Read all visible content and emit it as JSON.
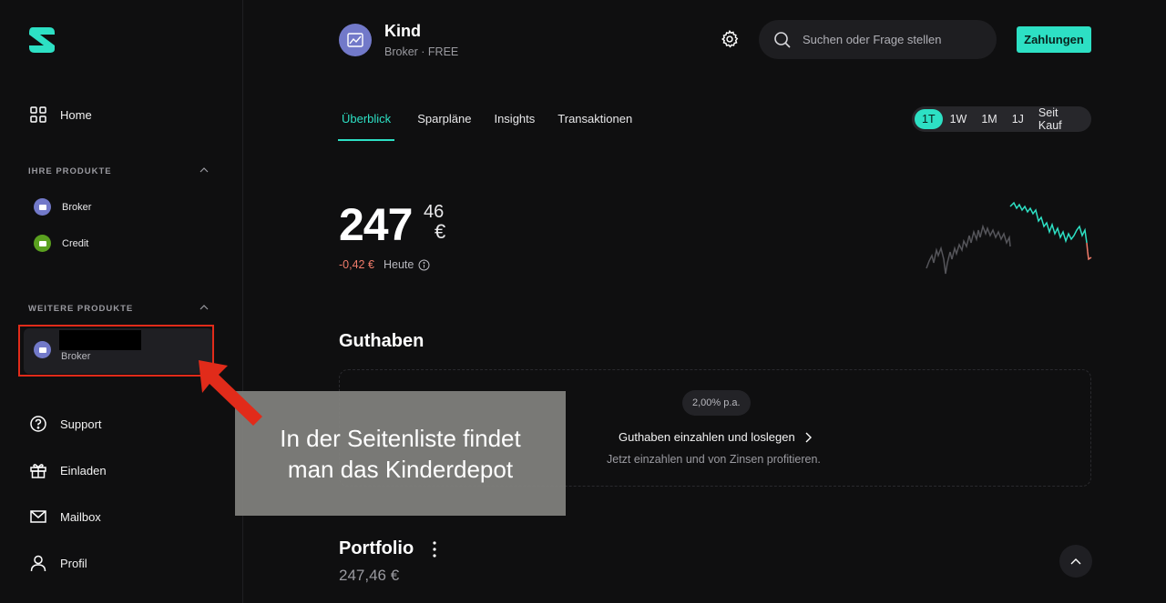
{
  "sidebar": {
    "nav_top": [
      {
        "label": "Home",
        "icon": "grid-icon"
      }
    ],
    "sections": {
      "own_products_title": "IHRE PRODUKTE",
      "other_products_title": "WEITERE PRODUKTE"
    },
    "own_products": [
      {
        "label": "Broker",
        "icon": "broker-icon",
        "color": "#7279c9"
      },
      {
        "label": "Credit",
        "icon": "credit-icon",
        "color": "#5aa01f"
      }
    ],
    "other_products": [
      {
        "label": "Broker",
        "icon": "broker-icon"
      }
    ],
    "nav_bottom": [
      {
        "label": "Support",
        "icon": "help-icon"
      },
      {
        "label": "Einladen",
        "icon": "gift-icon"
      },
      {
        "label": "Mailbox",
        "icon": "mail-icon"
      },
      {
        "label": "Profil",
        "icon": "user-icon"
      }
    ]
  },
  "header": {
    "account_name": "Kind",
    "account_sub": "Broker · FREE",
    "search_placeholder": "Suchen oder Frage stellen",
    "pay_button": "Zahlungen"
  },
  "tabs": [
    "Überblick",
    "Sparpläne",
    "Insights",
    "Transaktionen"
  ],
  "active_tab": "Überblick",
  "ranges": [
    "1T",
    "1W",
    "1M",
    "1J",
    "Seit Kauf"
  ],
  "active_range": "1T",
  "value": {
    "integer": "247",
    "decimal": "46",
    "currency": "€",
    "change": "-0,42 €",
    "change_label": "Heute",
    "change_color": "#f07b6a"
  },
  "guthaben": {
    "title": "Guthaben",
    "rate": "2,00% p.a.",
    "link": "Guthaben einzahlen und loslegen",
    "sub": "Jetzt einzahlen und von Zinsen profitieren."
  },
  "portfolio": {
    "title": "Portfolio",
    "value": "247,46 €"
  },
  "annotation": {
    "text": "In der Seitenliste findet man das Kinderdepot",
    "arrow_color": "#e12b1a"
  },
  "colors": {
    "accent": "#2de0c4",
    "background": "#0f0f10"
  }
}
